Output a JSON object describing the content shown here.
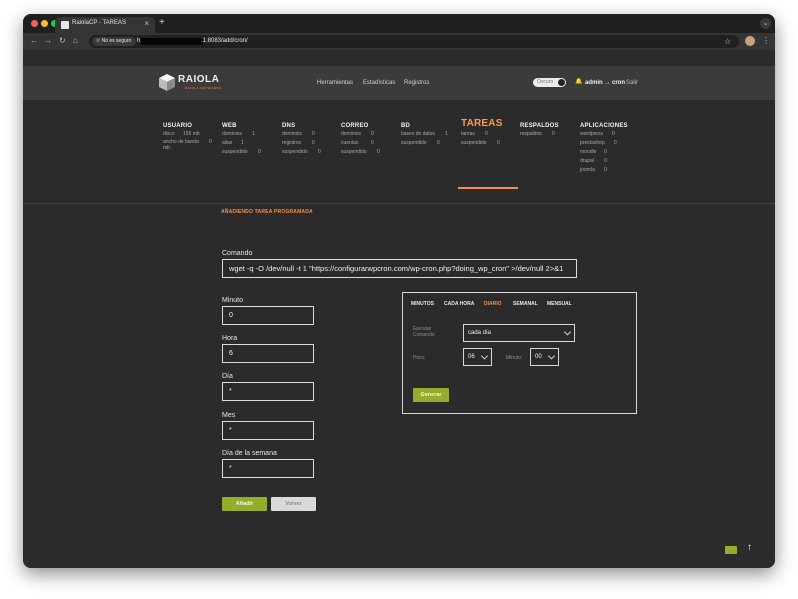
{
  "browser": {
    "tab_title": "RaiolaCP - TAREAS",
    "tab_close": "×",
    "new_tab": "+",
    "security_label": "No es seguro",
    "url_prefix": "h",
    "url_suffix": ":1:8083/add/cron/",
    "menu_glyph": "⌄"
  },
  "header": {
    "logo_text": "RAIOLA",
    "logo_sub": "RAIOLA NETWORKS",
    "nav": [
      "Herramientas",
      "Estadísticas",
      "Registros"
    ],
    "theme_label": "Oscuro",
    "user": "admin → cron",
    "logout": "Salir"
  },
  "stats": [
    {
      "head": "USUARIO",
      "rows": [
        {
          "k": "disco",
          "v": "155 mb"
        },
        {
          "k": "ancho de banda",
          "v": "0"
        },
        {
          "k": "mb",
          "v": ""
        }
      ]
    },
    {
      "head": "WEB",
      "rows": [
        {
          "k": "dominios",
          "v": "1"
        },
        {
          "k": "alias",
          "v": "1"
        },
        {
          "k": "suspendido",
          "v": "0"
        }
      ]
    },
    {
      "head": "DNS",
      "rows": [
        {
          "k": "dominios",
          "v": "0"
        },
        {
          "k": "registros",
          "v": "0"
        },
        {
          "k": "suspendido",
          "v": "0"
        }
      ]
    },
    {
      "head": "CORREO",
      "rows": [
        {
          "k": "dominios",
          "v": "0"
        },
        {
          "k": "cuentas",
          "v": "0"
        },
        {
          "k": "suspendido",
          "v": "0"
        }
      ]
    },
    {
      "head": "BD",
      "rows": [
        {
          "k": "bases de datos",
          "v": "1"
        },
        {
          "k": "suspendido",
          "v": "0"
        }
      ]
    },
    {
      "head": "TAREAS",
      "rows": [
        {
          "k": "tareas",
          "v": "0"
        },
        {
          "k": "suspendido",
          "v": "0"
        }
      ]
    },
    {
      "head": "RESPALDOS",
      "rows": [
        {
          "k": "respaldos",
          "v": "0"
        }
      ]
    },
    {
      "head": "APLICACIONES",
      "rows": [
        {
          "k": "wordpress",
          "v": "0"
        },
        {
          "k": "prestashop",
          "v": "0"
        },
        {
          "k": "moodle",
          "v": "0"
        },
        {
          "k": "drupal",
          "v": "0"
        },
        {
          "k": "joomla",
          "v": "0"
        }
      ]
    }
  ],
  "section_title": "AÑADIENDO TAREA PROGRAMADA",
  "form": {
    "command_label": "Comando",
    "command_value": "wget -q -O /dev/null -t 1 \"https://configurarwpcron.com/wp-cron.php?doing_wp_cron\" >/dev/null 2>&1",
    "minute_label": "Minuto",
    "minute_value": "0",
    "hour_label": "Hora",
    "hour_value": "6",
    "day_label": "Día",
    "day_value": "*",
    "month_label": "Mes",
    "month_value": "*",
    "weekday_label": "Día de la semana",
    "weekday_value": "*",
    "add_button": "Añadir",
    "back_button": "Volver"
  },
  "generator": {
    "tabs": [
      "MINUTOS",
      "CADA HORA",
      "DIARIO",
      "SEMANAL",
      "MENSUAL"
    ],
    "active_tab": "DIARIO",
    "run_label_1": "Ejecutar",
    "run_label_2": "Comando",
    "run_value": "cada día",
    "hour_label": "Hora:",
    "hour_value": "06",
    "minute_label": "Minuto:",
    "minute_value": "00",
    "generate_button": "Generar"
  },
  "colors": {
    "accent": "#ff8c42",
    "button_green": "#95ad2a",
    "page_bg": "#2b2b2b",
    "nav_bg": "#3b3b3b"
  }
}
